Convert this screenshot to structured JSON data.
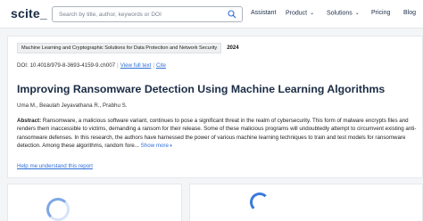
{
  "header": {
    "logo": "scite_",
    "search_placeholder": "Search by title, author, keywords or DOI",
    "nav": {
      "assistant": "Assistant",
      "product": "Product",
      "solutions": "Solutions",
      "pricing": "Pricing",
      "blog": "Blog"
    }
  },
  "paper": {
    "journal": "Machine Learning and Cryptographic Solutions for Data Protection and Network Security",
    "year": "2024",
    "doi": "DOI: 10.4018/979-8-3693-4159-9.ch007",
    "view_full_text": "View full text",
    "cite": "Cite",
    "title": "Improving Ransomware Detection Using Machine Learning Algorithms",
    "authors": "Uma M., Beaulah Jeyavathana R., Prabhu S.",
    "abstract_label": "Abstract:",
    "abstract_text": "Ransomware, a malicious software variant, continues to pose a significant threat in the realm of cybersecurity. This form of malware encrypts files and renders them inaccessible to victims, demanding a ransom for their release. Some of these malicious programs will undoubtedly attempt to circumvent existing anti-ransomware defenses. In this research, the authors have harnessed the power of various machine learning techniques to train and test models for ransomware detection. Among these algorithms, random fore...",
    "show_more": "Show more",
    "help_link": "Help me understand this report"
  }
}
